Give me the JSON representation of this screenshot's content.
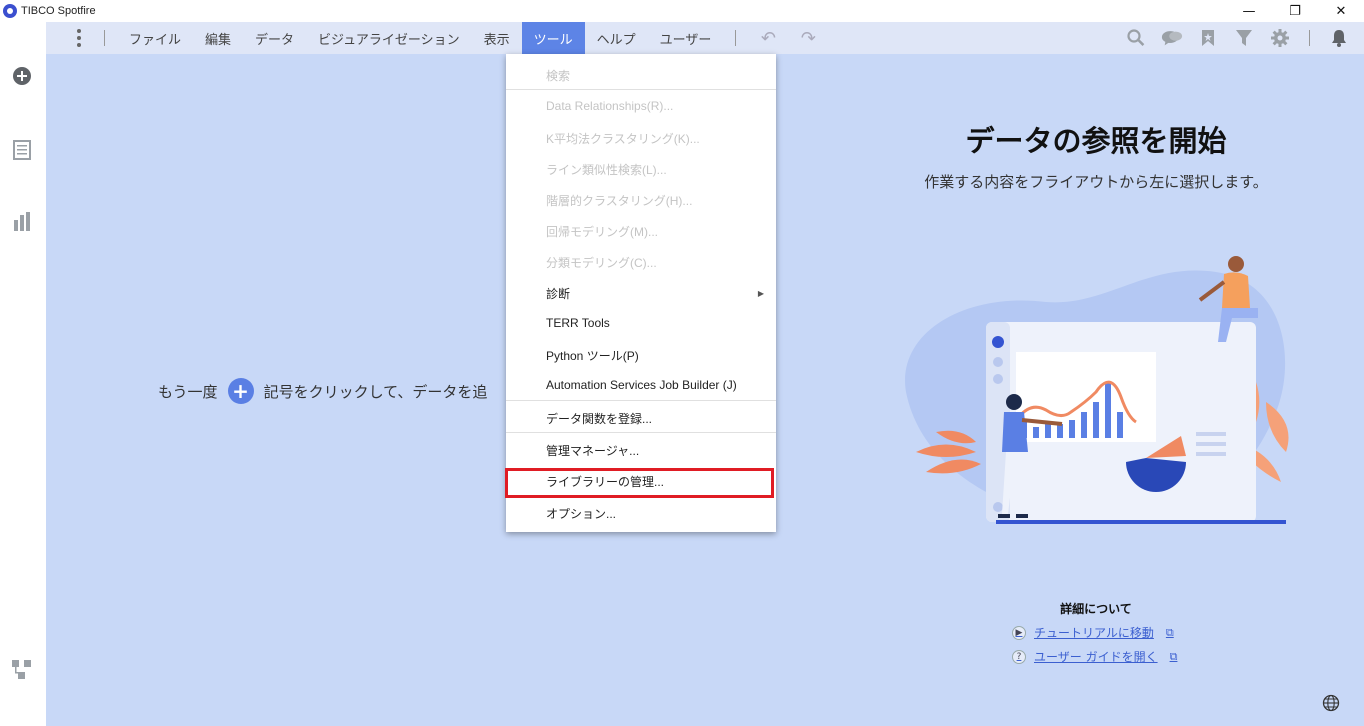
{
  "window": {
    "title": "TIBCO Spotfire",
    "minimize": "—",
    "restore": "❐",
    "close": "✕"
  },
  "menubar": {
    "items": [
      "ファイル",
      "編集",
      "データ",
      "ビジュアライゼーション",
      "表示",
      "ツール",
      "ヘルプ",
      "ユーザー"
    ],
    "active": "ツール",
    "undo": "↶",
    "redo": "↷"
  },
  "tools_menu": {
    "items": [
      {
        "label": "検索",
        "enabled": false
      },
      {
        "label": "Data Relationships(R)...",
        "enabled": false
      },
      {
        "label": "K平均法クラスタリング(K)...",
        "enabled": false
      },
      {
        "label": "ライン類似性検索(L)...",
        "enabled": false
      },
      {
        "label": "階層的クラスタリング(H)...",
        "enabled": false
      },
      {
        "label": "回帰モデリング(M)...",
        "enabled": false
      },
      {
        "label": "分類モデリング(C)...",
        "enabled": false
      },
      {
        "label": "診断",
        "enabled": true,
        "submenu": true
      },
      {
        "label": "TERR Tools",
        "enabled": true
      },
      {
        "label": "Python ツール(P)",
        "enabled": true
      },
      {
        "label": "Automation Services Job Builder (J)",
        "enabled": true
      },
      {
        "label": "データ関数を登録...",
        "enabled": true
      },
      {
        "label": "管理マネージャ...",
        "enabled": true
      },
      {
        "label": "ライブラリーの管理...",
        "enabled": true,
        "highlighted": true
      },
      {
        "label": "オプション...",
        "enabled": true
      }
    ]
  },
  "canvas": {
    "hint_before": "もう一度",
    "hint_after": "記号をクリックして、データを追",
    "hero_title": "データの参照を開始",
    "hero_subtitle": "作業する内容をフライアウトから左に選択します。",
    "learn_more_title": "詳細について",
    "tutorial_link": "チュートリアルに移動",
    "guide_link": "ユーザー ガイドを開く"
  },
  "colors": {
    "menubar_bg": "#dfe6f7",
    "canvas_bg": "#c8d8f7",
    "accent": "#5a7fe4",
    "highlight_border": "#e01c24"
  }
}
